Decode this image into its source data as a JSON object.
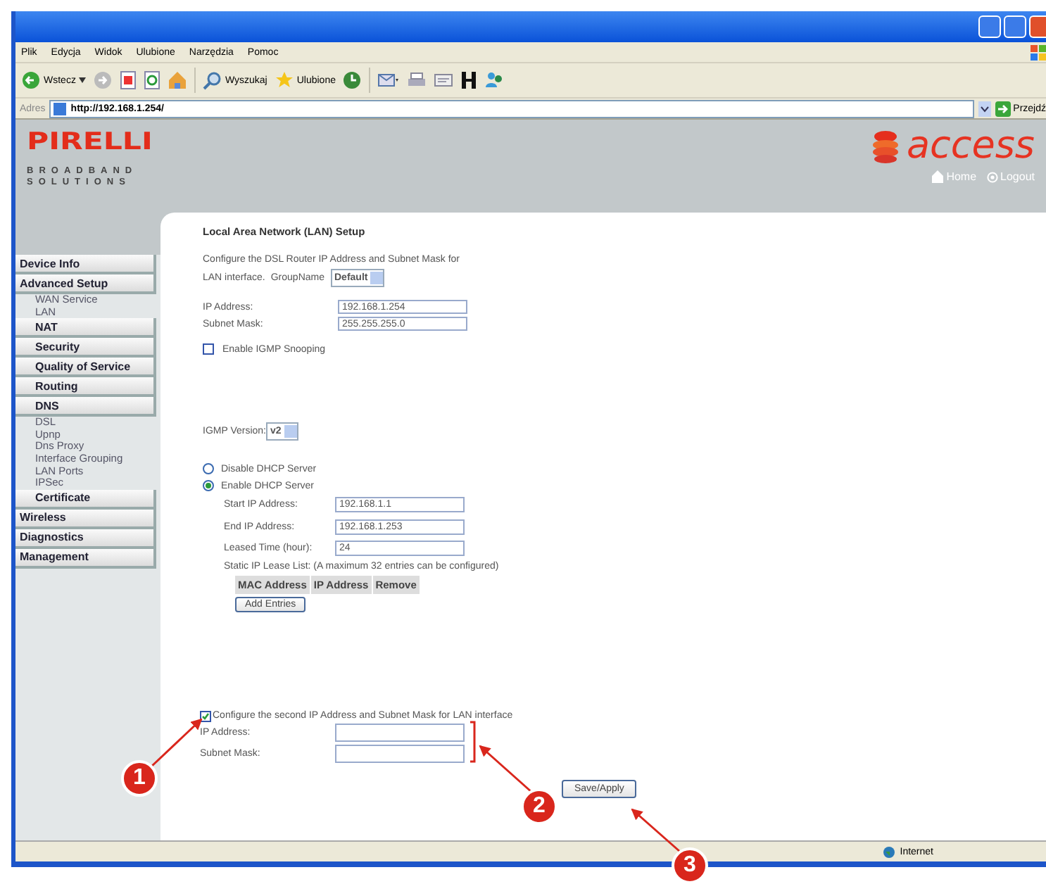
{
  "browser": {
    "menu": [
      "Plik",
      "Edycja",
      "Widok",
      "Ulubione",
      "Narzędzia",
      "Pomoc"
    ],
    "toolbar": {
      "back": "Wstecz",
      "search": "Wyszukaj",
      "favorites": "Ulubione"
    },
    "address": {
      "label": "Adres",
      "value": "http://192.168.1.254/",
      "go": "Przejdź"
    },
    "status": "Internet"
  },
  "header": {
    "logo": "PIRELLI",
    "tagline": [
      "BROADBAND",
      "SOLUTIONS"
    ],
    "brand": "access",
    "links": [
      "Home",
      "Logout"
    ]
  },
  "sidebar": {
    "items": [
      {
        "label": "Device Info",
        "kind": "button"
      },
      {
        "label": "Advanced Setup",
        "kind": "button",
        "children": [
          {
            "label": "WAN Service",
            "kind": "link"
          },
          {
            "label": "LAN",
            "kind": "link"
          },
          {
            "label": "NAT",
            "kind": "button"
          },
          {
            "label": "Security",
            "kind": "button"
          },
          {
            "label": "Quality of Service",
            "kind": "button"
          },
          {
            "label": "Routing",
            "kind": "button"
          },
          {
            "label": "DNS",
            "kind": "button"
          },
          {
            "label": "DSL",
            "kind": "link"
          },
          {
            "label": "Upnp",
            "kind": "link"
          },
          {
            "label": "Dns Proxy",
            "kind": "link"
          },
          {
            "label": "Interface Grouping",
            "kind": "link"
          },
          {
            "label": "LAN Ports",
            "kind": "link"
          },
          {
            "label": "IPSec",
            "kind": "link"
          },
          {
            "label": "Certificate",
            "kind": "button"
          }
        ]
      },
      {
        "label": "Wireless",
        "kind": "button"
      },
      {
        "label": "Diagnostics",
        "kind": "button"
      },
      {
        "label": "Management",
        "kind": "button"
      }
    ]
  },
  "page": {
    "title": "Local Area Network (LAN) Setup",
    "intro": [
      "Configure the DSL Router IP Address and Subnet Mask for",
      "LAN interface."
    ],
    "group_label": "GroupName",
    "group_value": "Default",
    "fields": [
      {
        "label": "IP Address:",
        "value": "192.168.1.254"
      },
      {
        "label": "Subnet Mask:",
        "value": "255.255.255.0"
      }
    ],
    "igmp_snooping": {
      "label": "Enable IGMP Snooping",
      "checked": false
    },
    "igmp_version": {
      "label": "IGMP Version:",
      "value": "v2"
    },
    "dhcp_options": [
      {
        "label": "Disable DHCP Server",
        "selected": false
      },
      {
        "label": "Enable DHCP Server",
        "selected": true
      }
    ],
    "dhcp_fields": [
      {
        "label": "Start IP Address:",
        "value": "192.168.1.1"
      },
      {
        "label": "End IP Address:",
        "value": "192.168.1.253"
      },
      {
        "label": "Leased Time (hour):",
        "value": "24"
      }
    ],
    "lease_note": "Static IP Lease List: (A maximum 32 entries can be configured)",
    "lease_columns": [
      "MAC Address",
      "IP Address",
      "Remove"
    ],
    "add_button": "Add Entries",
    "second_ip": {
      "label": "Configure the second IP Address and Subnet Mask for LAN interface",
      "checked": true
    },
    "second_fields": [
      {
        "label": "IP Address:"
      },
      {
        "label": "Subnet Mask:"
      }
    ],
    "save_button": "Save/Apply"
  },
  "callouts": [
    {
      "label": "1"
    },
    {
      "label": "2"
    },
    {
      "label": "3"
    }
  ]
}
